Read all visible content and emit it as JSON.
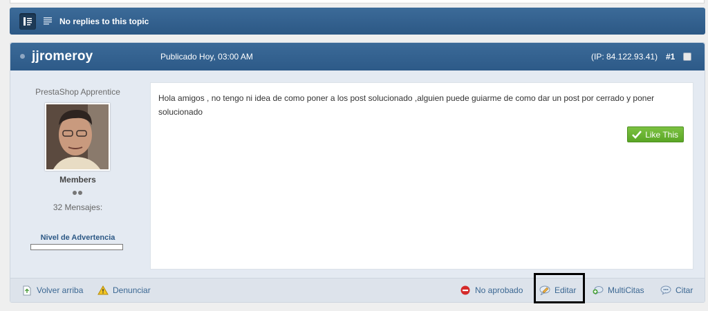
{
  "topic_bar": {
    "replies_text": "No replies to this topic"
  },
  "post": {
    "author": "jjromeroy",
    "date": "Publicado Hoy, 03:00 AM",
    "ip": "(IP: 84.122.93.41)",
    "number": "#1",
    "author_panel": {
      "rank": "PrestaShop Apprentice",
      "group": "Members",
      "post_count": "32 Mensajes:",
      "warning_label": "Nivel de Advertencia"
    },
    "body": "Hola amigos , no tengo ni idea de como poner a los post solucionado ,alguien puede guiarme de como dar un post por cerrado y poner solucionado",
    "like_label": "Like This",
    "footer": {
      "back_to_top": "Volver arriba",
      "report": "Denunciar",
      "unapproved": "No aprobado",
      "edit": "Editar",
      "multiquote": "MultiCitas",
      "quote": "Citar"
    }
  },
  "colors": {
    "header_blue": "#2c5885",
    "link_blue": "#3b6792",
    "like_green": "#5aa625"
  },
  "icons": [
    "moderation-icon",
    "list-icon",
    "online-status-icon",
    "checkbox-icon",
    "checkmark-icon",
    "page-up-icon",
    "warning-icon",
    "no-entry-icon",
    "edit-icon",
    "multiquote-icon",
    "quote-icon"
  ]
}
